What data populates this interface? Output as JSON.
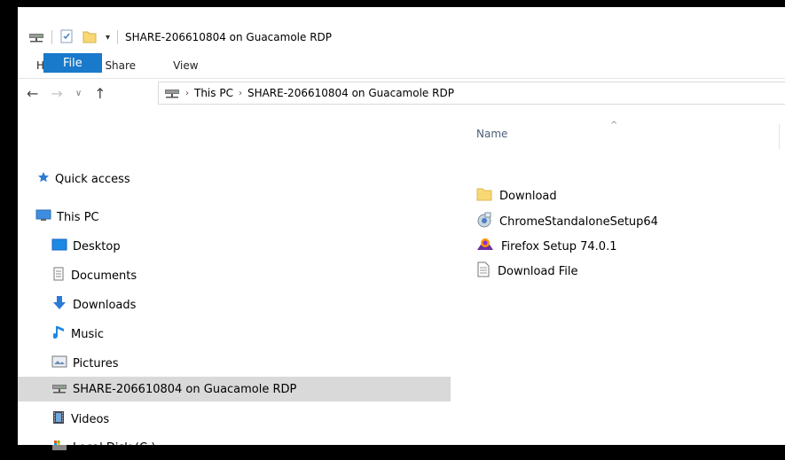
{
  "window": {
    "title": "SHARE-206610804 on Guacamole RDP"
  },
  "ribbon": {
    "tabs": [
      "File",
      "Home",
      "Share",
      "View"
    ]
  },
  "address": {
    "crumbs": [
      "This PC",
      "SHARE-206610804 on Guacamole RDP"
    ]
  },
  "nav_pane": {
    "items": [
      {
        "label": "Quick access",
        "icon": "star-icon"
      },
      {
        "label": "This PC",
        "icon": "computer-icon"
      },
      {
        "label": "Desktop",
        "icon": "desktop-icon"
      },
      {
        "label": "Documents",
        "icon": "documents-icon"
      },
      {
        "label": "Downloads",
        "icon": "download-arrow-icon"
      },
      {
        "label": "Music",
        "icon": "music-note-icon"
      },
      {
        "label": "Pictures",
        "icon": "pictures-icon"
      },
      {
        "label": "SHARE-206610804 on Guacamole RDP",
        "icon": "network-drive-icon",
        "selected": true
      },
      {
        "label": "Videos",
        "icon": "videos-icon"
      },
      {
        "label": "Local Disk (C:)",
        "icon": "local-disk-icon"
      }
    ]
  },
  "file_list": {
    "column_name": "Name",
    "files": [
      {
        "name": "Download",
        "icon": "folder-icon"
      },
      {
        "name": "ChromeStandaloneSetup64",
        "icon": "installer-icon"
      },
      {
        "name": "Firefox Setup 74.0.1",
        "icon": "firefox-setup-icon"
      },
      {
        "name": "Download File",
        "icon": "text-file-icon"
      }
    ]
  },
  "colors": {
    "file_tab": "#1979ca",
    "selected_row": "#d9d9d9",
    "folder": "#f8d775"
  }
}
